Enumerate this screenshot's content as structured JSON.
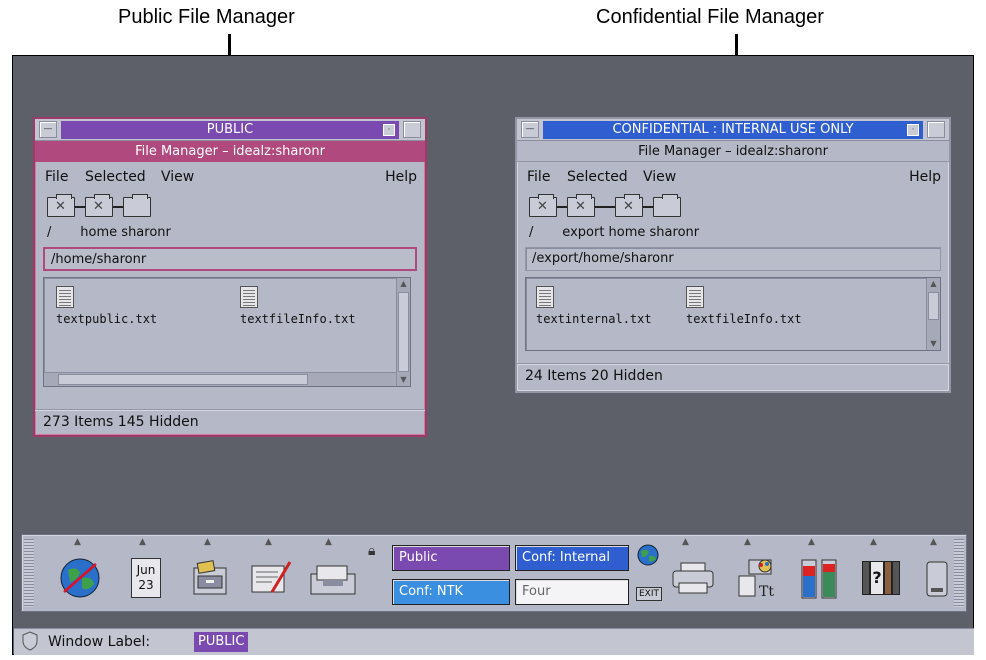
{
  "callouts": {
    "public": "Public File Manager",
    "confidential": "Confidential File Manager"
  },
  "colors": {
    "desktop": "#5d6068",
    "public_label": "#7a4ab0",
    "public_title": "#b04a7e",
    "confidential_label": "#2f5ed1",
    "conf_ntk": "#3b8fe0"
  },
  "public_window": {
    "label": "PUBLIC",
    "title": "File Manager – idealz:sharonr",
    "menus": [
      "File",
      "Selected",
      "View",
      "Help"
    ],
    "path_segments": "/       home sharonr",
    "path_field": "/home/sharonr",
    "files": [
      "textpublic.txt",
      "textfileInfo.txt"
    ],
    "status": "273 Items 145 Hidden"
  },
  "confidential_window": {
    "label": "CONFIDENTIAL : INTERNAL USE ONLY",
    "title": "File Manager – idealz:sharonr",
    "menus": [
      "File",
      "Selected",
      "View",
      "Help"
    ],
    "path_segments": "/       export home sharonr",
    "path_field": "/export/home/sharonr",
    "files": [
      "textinternal.txt",
      "textfileInfo.txt"
    ],
    "status": "24 Items 20 Hidden"
  },
  "front_panel": {
    "calendar_month": "Jun",
    "calendar_day": "23",
    "workspaces": {
      "public": "Public",
      "conf_internal": "Conf: Internal",
      "conf_ntk": "Conf: NTK",
      "four": "Four"
    },
    "exit_label": "EXIT",
    "help_label": "?",
    "icons": [
      "globe-icon",
      "calendar-icon",
      "file-drawer-icon",
      "text-editor-icon",
      "mail-icon",
      "lock-icon",
      "earth-icon",
      "printer-icon",
      "style-manager-icon",
      "performance-meter-icon",
      "help-books-icon",
      "trash-icon"
    ]
  },
  "window_label_bar": {
    "label": "Window Label:",
    "value": "PUBLIC"
  }
}
